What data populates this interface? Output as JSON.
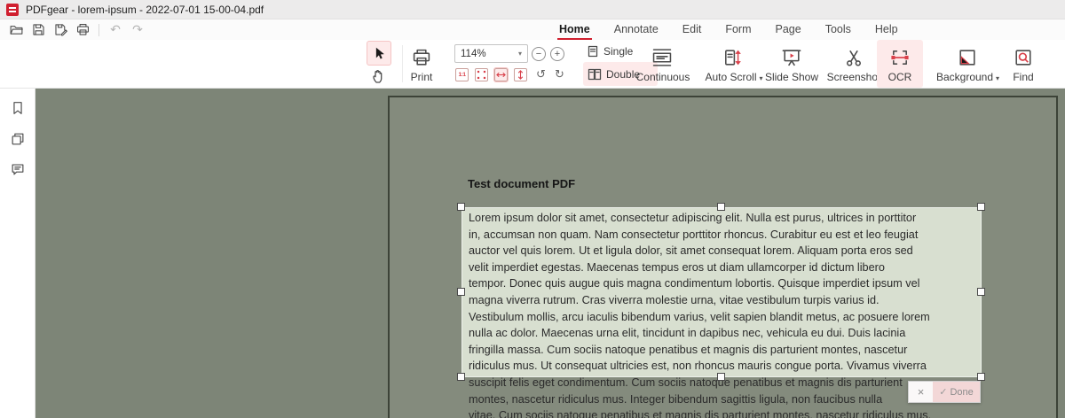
{
  "window": {
    "title": "PDFgear - lorem-ipsum - 2022-07-01 15-00-04.pdf"
  },
  "quick_access": {
    "icons": [
      "open-icon",
      "save-icon",
      "save-as-icon",
      "print-icon",
      "undo-icon",
      "redo-icon"
    ],
    "undo_glyph": "↶",
    "redo_glyph": "↷"
  },
  "tabs": {
    "items": [
      "Home",
      "Annotate",
      "Edit",
      "Form",
      "Page",
      "Tools",
      "Help"
    ],
    "active": "Home"
  },
  "ribbon": {
    "print": "Print",
    "zoom_value": "114%",
    "zoom_out": "−",
    "zoom_in": "+",
    "actual_size": "1:1",
    "rotate_left_glyph": "↺",
    "rotate_right_glyph": "↻",
    "single": "Single",
    "double": "Double",
    "continuous": "Continuous",
    "auto_scroll": "Auto Scroll",
    "slide_show": "Slide Show",
    "screenshot": "Screenshot",
    "ocr": "OCR",
    "background": "Background",
    "find": "Find",
    "caret": "▾"
  },
  "sidebar": {
    "icons": [
      "bookmark-icon",
      "pages-icon",
      "comment-icon"
    ]
  },
  "document": {
    "heading": "Test document PDF",
    "lines": [
      "Lorem ipsum dolor sit amet, consectetur adipiscing elit. Nulla est purus, ultrices in porttitor",
      "in, accumsan non quam. Nam consectetur porttitor rhoncus. Curabitur eu est et leo feugiat",
      "auctor vel quis lorem. Ut et ligula dolor, sit amet consequat lorem. Aliquam porta eros sed",
      "velit imperdiet egestas. Maecenas tempus eros ut diam ullamcorper id dictum libero",
      "tempor. Donec quis augue quis magna condimentum lobortis. Quisque imperdiet ipsum vel",
      "magna viverra rutrum. Cras viverra molestie urna, vitae vestibulum turpis varius id.",
      "Vestibulum mollis, arcu iaculis bibendum varius, velit sapien blandit metus, ac posuere lorem",
      "nulla ac dolor. Maecenas urna elit, tincidunt in dapibus nec, vehicula eu dui. Duis lacinia",
      "fringilla massa. Cum sociis natoque penatibus et magnis dis parturient montes, nascetur",
      "ridiculus mus. Ut consequat ultricies est, non rhoncus mauris congue porta. Vivamus viverra",
      "suscipit felis eget condimentum. Cum sociis natoque penatibus et magnis dis parturient",
      "montes, nascetur ridiculus mus. Integer bibendum sagittis ligula, non faucibus nulla",
      "vitae. Cum sociis natoque penatibus et magnis dis parturient montes, nascetur ridiculus mus."
    ]
  },
  "ocr_popup": {
    "close": "×",
    "check": "✓",
    "done": "Done"
  },
  "colors": {
    "accent": "#d01f2f",
    "highlight_pink": "#fdeaea",
    "canvas": "#7d8577",
    "page": "#848b7d",
    "selection": "#d8dfd0",
    "red_icon": "#d9404a"
  }
}
